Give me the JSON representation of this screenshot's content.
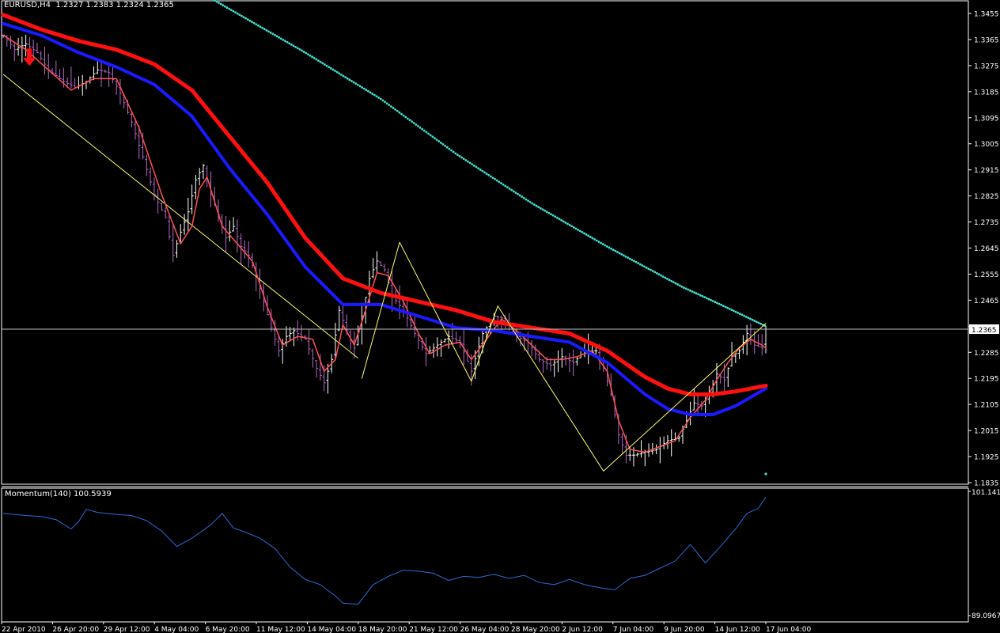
{
  "header": {
    "symbol": "EURUSD,H4",
    "ohlc": "1.2327 1.2383 1.2324 1.2365"
  },
  "current_price_label": "1.2365",
  "subwindow": {
    "title": "Momentum(140) 100.5939",
    "max_label": "101.1414",
    "min_label": "89.0967"
  },
  "colors": {
    "background": "#000000",
    "axis": "#ffffff",
    "bar_up": "#ffffff",
    "bar_down": "#b469c8",
    "fast_ma": "#ff5050",
    "ma_blue": "#1a1aff",
    "ma_red": "#ff1010",
    "dotted_ma": "#40e0d0",
    "zigzag": "#ffff66",
    "momentum": "#2e6bd6",
    "signal_arrow": "#ff1010"
  },
  "chart_data": [
    {
      "type": "line",
      "title": "EURUSD,H4",
      "ylim": [
        1.1835,
        1.3455
      ],
      "y_ticks": [
        "1.3455",
        "1.3365",
        "1.3275",
        "1.3185",
        "1.3095",
        "1.3005",
        "1.2915",
        "1.2825",
        "1.2735",
        "1.2645",
        "1.2555",
        "1.2465",
        "1.2375",
        "1.2285",
        "1.2195",
        "1.2105",
        "1.2015",
        "1.1925",
        "1.1835"
      ],
      "x_tick_labels": [
        "22 Apr 2010",
        "26 Apr 20:00",
        "29 Apr 12:00",
        "4 May 04:00",
        "6 May 20:00",
        "11 May 12:00",
        "14 May 04:00",
        "18 May 20:00",
        "21 May 12:00",
        "26 May 04:00",
        "28 May 20:00",
        "2 Jun 12:00",
        "7 Jun 04:00",
        "9 Jun 20:00",
        "14 Jun 12:00",
        "17 Jun 04:00"
      ],
      "price_path": [
        [
          0,
          1.338
        ],
        [
          3,
          1.333
        ],
        [
          6,
          1.335
        ],
        [
          9,
          1.332
        ],
        [
          12,
          1.326
        ],
        [
          16,
          1.322
        ],
        [
          19,
          1.32
        ],
        [
          22,
          1.322
        ],
        [
          25,
          1.326
        ],
        [
          28,
          1.325
        ],
        [
          31,
          1.318
        ],
        [
          34,
          1.308
        ],
        [
          37,
          1.296
        ],
        [
          40,
          1.283
        ],
        [
          43,
          1.275
        ],
        [
          45,
          1.262
        ],
        [
          47,
          1.27
        ],
        [
          49,
          1.277
        ],
        [
          51,
          1.288
        ],
        [
          53,
          1.293
        ],
        [
          55,
          1.283
        ],
        [
          57,
          1.276
        ],
        [
          59,
          1.268
        ],
        [
          61,
          1.272
        ],
        [
          63,
          1.265
        ],
        [
          65,
          1.262
        ],
        [
          67,
          1.255
        ],
        [
          69,
          1.246
        ],
        [
          71,
          1.237
        ],
        [
          73,
          1.229
        ],
        [
          75,
          1.234
        ],
        [
          77,
          1.236
        ],
        [
          80,
          1.233
        ],
        [
          83,
          1.223
        ],
        [
          85,
          1.218
        ],
        [
          87,
          1.226
        ],
        [
          89,
          1.243
        ],
        [
          91,
          1.236
        ],
        [
          93,
          1.23
        ],
        [
          95,
          1.241
        ],
        [
          97,
          1.254
        ],
        [
          99,
          1.26
        ],
        [
          101,
          1.257
        ],
        [
          103,
          1.248
        ],
        [
          106,
          1.243
        ],
        [
          109,
          1.235
        ],
        [
          112,
          1.228
        ],
        [
          115,
          1.231
        ],
        [
          118,
          1.234
        ],
        [
          121,
          1.232
        ],
        [
          124,
          1.222
        ],
        [
          127,
          1.235
        ],
        [
          130,
          1.241
        ],
        [
          133,
          1.24
        ],
        [
          136,
          1.234
        ],
        [
          139,
          1.232
        ],
        [
          142,
          1.226
        ],
        [
          145,
          1.224
        ],
        [
          148,
          1.227
        ],
        [
          151,
          1.225
        ],
        [
          154,
          1.229
        ],
        [
          157,
          1.229
        ],
        [
          159,
          1.223
        ],
        [
          161,
          1.214
        ],
        [
          163,
          1.2
        ],
        [
          165,
          1.193
        ],
        [
          167,
          1.193
        ],
        [
          170,
          1.194
        ],
        [
          173,
          1.195
        ],
        [
          176,
          1.198
        ],
        [
          179,
          1.199
        ],
        [
          181,
          1.205
        ],
        [
          183,
          1.211
        ],
        [
          185,
          1.21
        ],
        [
          187,
          1.214
        ],
        [
          189,
          1.221
        ],
        [
          191,
          1.219
        ],
        [
          193,
          1.227
        ],
        [
          195,
          1.229
        ],
        [
          197,
          1.235
        ],
        [
          199,
          1.231
        ],
        [
          201,
          1.23
        ],
        [
          202,
          1.2365
        ]
      ],
      "series": [
        {
          "name": "",
          "style": "fast_ma",
          "points": [
            [
              0,
              1.338
            ],
            [
              6,
              1.333
            ],
            [
              12,
              1.326
            ],
            [
              18,
              1.319
            ],
            [
              24,
              1.323
            ],
            [
              30,
              1.323
            ],
            [
              36,
              1.306
            ],
            [
              42,
              1.283
            ],
            [
              47,
              1.266
            ],
            [
              50,
              1.272
            ],
            [
              52,
              1.285
            ],
            [
              54,
              1.289
            ],
            [
              58,
              1.272
            ],
            [
              62,
              1.266
            ],
            [
              66,
              1.26
            ],
            [
              70,
              1.244
            ],
            [
              74,
              1.231
            ],
            [
              78,
              1.234
            ],
            [
              82,
              1.233
            ],
            [
              85,
              1.222
            ],
            [
              88,
              1.226
            ],
            [
              90,
              1.238
            ],
            [
              93,
              1.231
            ],
            [
              96,
              1.243
            ],
            [
              99,
              1.256
            ],
            [
              102,
              1.255
            ],
            [
              106,
              1.246
            ],
            [
              110,
              1.235
            ],
            [
              113,
              1.228
            ],
            [
              117,
              1.231
            ],
            [
              121,
              1.232
            ],
            [
              124,
              1.226
            ],
            [
              128,
              1.233
            ],
            [
              132,
              1.24
            ],
            [
              136,
              1.236
            ],
            [
              140,
              1.231
            ],
            [
              144,
              1.226
            ],
            [
              148,
              1.226
            ],
            [
              152,
              1.227
            ],
            [
              156,
              1.229
            ],
            [
              160,
              1.222
            ],
            [
              163,
              1.205
            ],
            [
              166,
              1.195
            ],
            [
              170,
              1.194
            ],
            [
              174,
              1.196
            ],
            [
              178,
              1.198
            ],
            [
              182,
              1.206
            ],
            [
              186,
              1.212
            ],
            [
              189,
              1.219
            ],
            [
              192,
              1.225
            ],
            [
              195,
              1.23
            ],
            [
              198,
              1.233
            ],
            [
              201,
              1.231
            ],
            [
              202,
              1.23
            ]
          ]
        },
        {
          "name": "",
          "style": "ma_blue",
          "points": [
            [
              0,
              1.342
            ],
            [
              10,
              1.338
            ],
            [
              20,
              1.332
            ],
            [
              30,
              1.327
            ],
            [
              40,
              1.321
            ],
            [
              50,
              1.31
            ],
            [
              60,
              1.292
            ],
            [
              70,
              1.276
            ],
            [
              80,
              1.258
            ],
            [
              90,
              1.245
            ],
            [
              100,
              1.245
            ],
            [
              110,
              1.241
            ],
            [
              120,
              1.237
            ],
            [
              130,
              1.236
            ],
            [
              140,
              1.234
            ],
            [
              150,
              1.232
            ],
            [
              160,
              1.225
            ],
            [
              170,
              1.214
            ],
            [
              176,
              1.209
            ],
            [
              182,
              1.207
            ],
            [
              188,
              1.207
            ],
            [
              194,
              1.21
            ],
            [
              202,
              1.216
            ]
          ]
        },
        {
          "name": "",
          "style": "ma_red",
          "points": [
            [
              0,
              1.345
            ],
            [
              10,
              1.34
            ],
            [
              20,
              1.336
            ],
            [
              30,
              1.333
            ],
            [
              40,
              1.328
            ],
            [
              50,
              1.319
            ],
            [
              60,
              1.303
            ],
            [
              70,
              1.287
            ],
            [
              80,
              1.268
            ],
            [
              90,
              1.254
            ],
            [
              100,
              1.249
            ],
            [
              110,
              1.246
            ],
            [
              120,
              1.243
            ],
            [
              130,
              1.239
            ],
            [
              140,
              1.237
            ],
            [
              150,
              1.235
            ],
            [
              160,
              1.229
            ],
            [
              170,
              1.22
            ],
            [
              176,
              1.216
            ],
            [
              182,
              1.214
            ],
            [
              188,
              1.214
            ],
            [
              194,
              1.215
            ],
            [
              202,
              1.217
            ]
          ]
        },
        {
          "name": "",
          "style": "dotted_ma",
          "points": [
            [
              56,
              1.35
            ],
            [
              80,
              1.332
            ],
            [
              100,
              1.316
            ],
            [
              120,
              1.297
            ],
            [
              140,
              1.28
            ],
            [
              160,
              1.265
            ],
            [
              180,
              1.251
            ],
            [
              190,
              1.245
            ],
            [
              202,
              1.2375
            ]
          ]
        },
        {
          "name": "",
          "style": "zigzag",
          "points": [
            [
              95,
              1.2195
            ],
            [
              105,
              1.2665
            ],
            [
              124,
              1.2185
            ],
            [
              131,
              1.2445
            ],
            [
              159,
              1.1875
            ],
            [
              202,
              1.2385
            ]
          ]
        }
      ],
      "channel_line": [
        [
          0,
          1.3245
        ],
        [
          94,
          1.2265
        ]
      ],
      "current_price": 1.2365,
      "signal_arrow": [
        [
          4,
          1.3285
        ]
      ],
      "stray_dot": [
        [
          202,
          1.1865
        ]
      ]
    },
    {
      "type": "line",
      "title": "Momentum(140) 100.5939",
      "ylim": [
        89.0967,
        101.1414
      ],
      "series": [
        {
          "name": "",
          "style": "momentum",
          "points": [
            [
              0,
              99.0
            ],
            [
              6,
              98.8
            ],
            [
              10,
              98.7
            ],
            [
              14,
              98.4
            ],
            [
              18,
              97.5
            ],
            [
              20,
              98.2
            ],
            [
              22,
              99.4
            ],
            [
              25,
              99.1
            ],
            [
              30,
              98.9
            ],
            [
              34,
              98.8
            ],
            [
              38,
              98.3
            ],
            [
              42,
              97.3
            ],
            [
              46,
              95.8
            ],
            [
              50,
              96.6
            ],
            [
              55,
              97.9
            ],
            [
              58,
              99.0
            ],
            [
              61,
              97.6
            ],
            [
              64,
              97.2
            ],
            [
              68,
              96.6
            ],
            [
              72,
              95.6
            ],
            [
              76,
              93.8
            ],
            [
              80,
              92.6
            ],
            [
              84,
              92.1
            ],
            [
              88,
              91.0
            ],
            [
              90,
              90.3
            ],
            [
              94,
              90.2
            ],
            [
              98,
              92.1
            ],
            [
              102,
              92.9
            ],
            [
              106,
              93.5
            ],
            [
              110,
              93.4
            ],
            [
              114,
              93.2
            ],
            [
              118,
              92.5
            ],
            [
              122,
              92.9
            ],
            [
              126,
              92.8
            ],
            [
              130,
              93.1
            ],
            [
              134,
              92.7
            ],
            [
              138,
              93.0
            ],
            [
              142,
              92.3
            ],
            [
              146,
              92.1
            ],
            [
              150,
              92.6
            ],
            [
              154,
              92.1
            ],
            [
              158,
              91.8
            ],
            [
              162,
              91.6
            ],
            [
              166,
              92.7
            ],
            [
              170,
              93.0
            ],
            [
              174,
              93.7
            ],
            [
              178,
              94.4
            ],
            [
              182,
              96.0
            ],
            [
              186,
              94.2
            ],
            [
              190,
              95.8
            ],
            [
              194,
              97.5
            ],
            [
              197,
              99.0
            ],
            [
              200,
              99.5
            ],
            [
              202,
              100.6
            ]
          ]
        }
      ]
    }
  ]
}
